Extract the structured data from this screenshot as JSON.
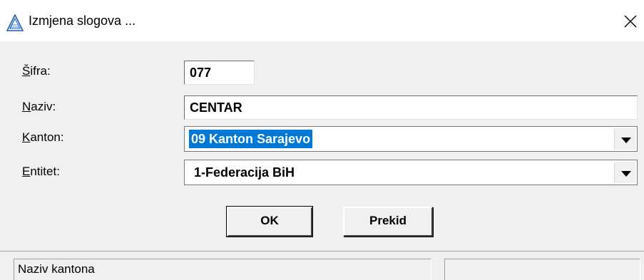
{
  "window": {
    "title": "Izmjena slogova ...",
    "close_glyph": "✕",
    "icon": "app-triangle-icon"
  },
  "form": {
    "sifra": {
      "label_ul": "Š",
      "label_rest": "ifra:",
      "value": "077"
    },
    "naziv": {
      "label_ul": "N",
      "label_rest": "aziv:",
      "value": "CENTAR"
    },
    "kanton": {
      "label_ul": "K",
      "label_rest": "anton:",
      "value": "09 Kanton Sarajevo"
    },
    "entitet": {
      "label_ul": "E",
      "label_rest": "ntitet:",
      "value": "1-Federacija BiH"
    }
  },
  "buttons": {
    "ok_label": "OK",
    "cancel_label": "Prekid"
  },
  "statusbar": {
    "pane1": "Naziv kantona",
    "pane2": ""
  },
  "colors": {
    "selection": "#0078d7",
    "dialog_bg": "#f0f0f0",
    "title_bg": "#ffffff"
  }
}
